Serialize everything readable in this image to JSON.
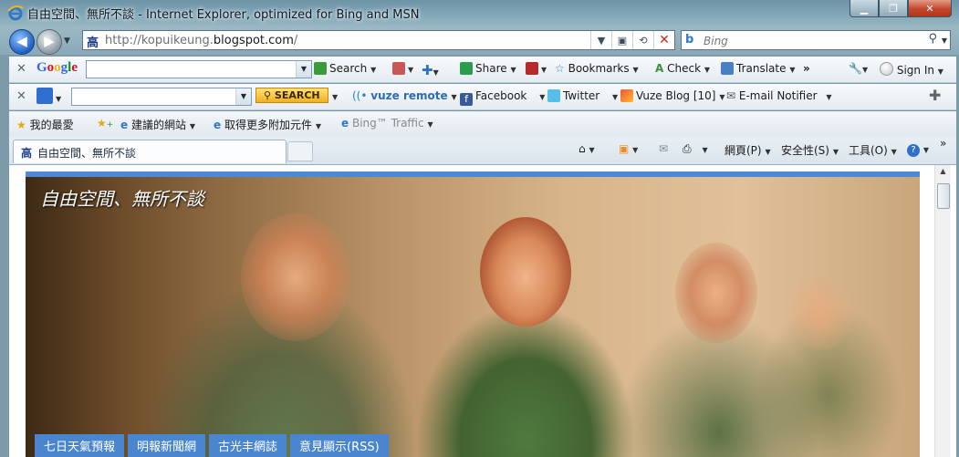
{
  "window": {
    "title": "自由空間、無所不談 - Internet Explorer, optimized for Bing and MSN",
    "caption_buttons": [
      "▁",
      "❐",
      "✕"
    ]
  },
  "address_bar": {
    "url_prefix": "http://kopuikeung.",
    "url_domain": "blogspot.com",
    "url_suffix": "/",
    "favicon": "高"
  },
  "search": {
    "placeholder": "Bing",
    "logo": "b"
  },
  "google_toolbar": {
    "logo": "Google",
    "search_label": "Search",
    "share_label": "Share",
    "bookmarks_label": "Bookmarks",
    "check_label": "Check",
    "translate_label": "Translate",
    "more": "»",
    "signin_label": "Sign In"
  },
  "vuze_toolbar": {
    "search_button": "SEARCH",
    "vuze_remote": "vuze remote",
    "facebook": "Facebook",
    "twitter": "Twitter",
    "vuze_blog": "Vuze Blog",
    "vuze_blog_count": "[10]",
    "email_notifier": "E-mail Notifier"
  },
  "favorites_bar": {
    "favorites_label": "我的最愛",
    "suggested_sites": "建議的網站",
    "get_addons": "取得更多附加元件",
    "bing_traffic": "Bing™ Traffic"
  },
  "tab": {
    "favicon": "高",
    "title": "自由空間、無所不談"
  },
  "command_bar": {
    "page_menu": "網頁(P)",
    "safety_menu": "安全性(S)",
    "tools_menu": "工具(O)",
    "more": "»"
  },
  "blog": {
    "title": "自由空間、無所不談",
    "nav_links": [
      "七日天氣預報",
      "明報新聞網",
      "古光丰網誌",
      "意見顯示(RSS)"
    ]
  }
}
